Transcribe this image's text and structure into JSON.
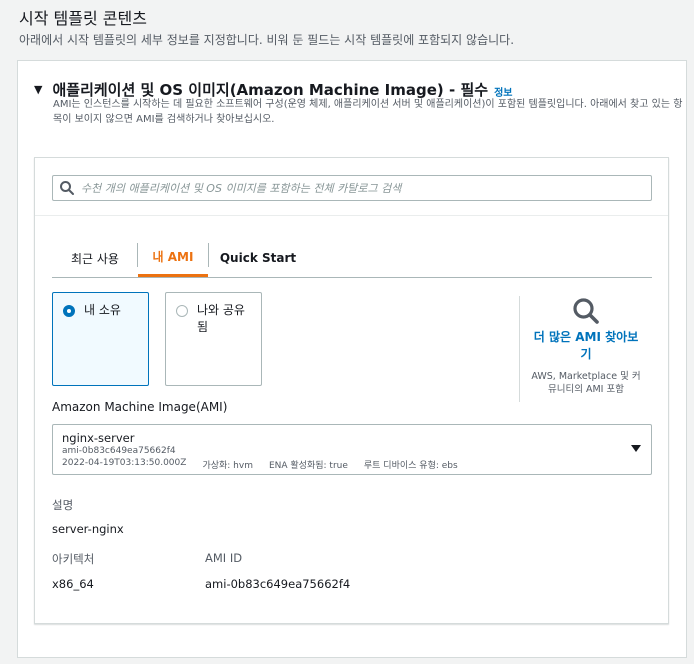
{
  "page": {
    "title": "시작 템플릿 콘텐츠",
    "subtitle": "아래에서 시작 템플릿의 세부 정보를 지정합니다. 비워 둔 필드는 시작 템플릿에 포함되지 않습니다."
  },
  "section": {
    "title": "애플리케이션 및 OS 이미지(Amazon Machine Image) - 필수",
    "info_link": "정보",
    "description": "AMI는 인스턴스를 시작하는 데 필요한 소프트웨어 구성(운영 체제, 애플리케이션 서버 및 애플리케이션)이 포함된 템플릿입니다. 아래에서 찾고 있는 항목이 보이지 않으면 AMI를 검색하거나 찾아보십시오."
  },
  "search": {
    "placeholder": "수천 개의 애플리케이션 및 OS 이미지를 포함하는 전체 카탈로그 검색",
    "value": ""
  },
  "tabs": [
    {
      "label": "최근 사용",
      "active": false
    },
    {
      "label": "내 AMI",
      "active": true
    },
    {
      "label": "Quick Start",
      "active": false
    }
  ],
  "ownership": [
    {
      "label": "내 소유",
      "selected": true
    },
    {
      "label": "나와 공유됨",
      "selected": false
    }
  ],
  "browse": {
    "link": "더 많은 AMI 찾아보기",
    "sub": "AWS, Marketplace 및 커뮤니티의 AMI 포함"
  },
  "ami_select": {
    "label": "Amazon Machine Image(AMI)",
    "name": "nginx-server",
    "id": "ami-0b83c649ea75662f4",
    "date": "2022-04-19T03:13:50.000Z",
    "virtualization": "가상화: hvm",
    "ena": "ENA 활성화됨: true",
    "root_device": "루트 디바이스 유형: ebs"
  },
  "details": {
    "description_label": "설명",
    "description_value": "server-nginx",
    "architecture_label": "아키텍처",
    "architecture_value": "x86_64",
    "ami_id_label": "AMI ID",
    "ami_id_value": "ami-0b83c649ea75662f4"
  },
  "colors": {
    "accent_orange": "#ec7211",
    "link_blue": "#0073bb",
    "border": "#aab7b8"
  }
}
